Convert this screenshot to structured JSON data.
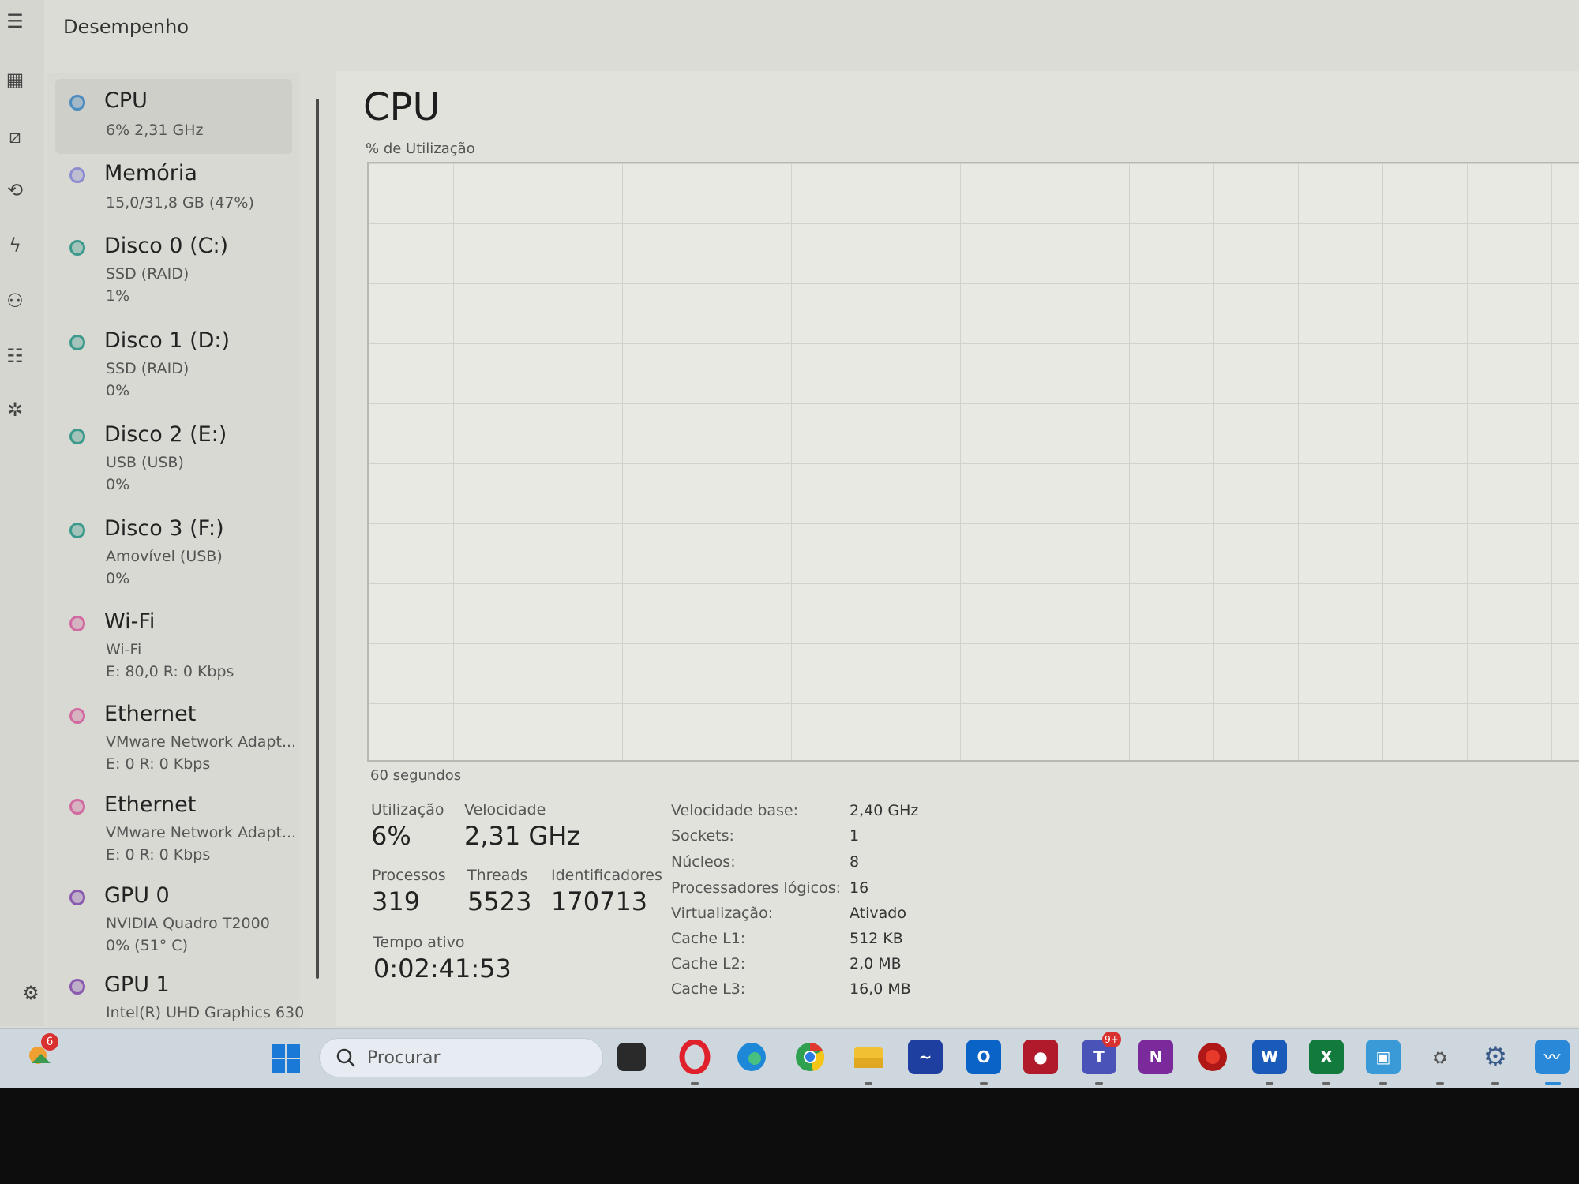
{
  "header": {
    "title": "Desempenho"
  },
  "devices": [
    {
      "name": "CPU",
      "lines": [
        "6%  2,31 GHz"
      ],
      "color": "#4a8bc0"
    },
    {
      "name": "Memória",
      "lines": [
        "15,0/31,8 GB (47%)"
      ],
      "color": "#8c8cd0"
    },
    {
      "name": "Disco 0 (C:)",
      "lines": [
        "SSD (RAID)",
        "1%"
      ],
      "color": "#3c9a8c"
    },
    {
      "name": "Disco 1 (D:)",
      "lines": [
        "SSD (RAID)",
        "0%"
      ],
      "color": "#3c9a8c"
    },
    {
      "name": "Disco 2 (E:)",
      "lines": [
        "USB (USB)",
        "0%"
      ],
      "color": "#3c9a8c"
    },
    {
      "name": "Disco 3 (F:)",
      "lines": [
        "Amovível (USB)",
        "0%"
      ],
      "color": "#3c9a8c"
    },
    {
      "name": "Wi-Fi",
      "lines": [
        "Wi-Fi",
        "E: 80,0  R: 0 Kbps"
      ],
      "color": "#d06aa0"
    },
    {
      "name": "Ethernet",
      "lines": [
        "VMware Network Adapt...",
        "E: 0  R: 0 Kbps"
      ],
      "color": "#d06aa0"
    },
    {
      "name": "Ethernet",
      "lines": [
        "VMware Network Adapt...",
        "E: 0  R: 0 Kbps"
      ],
      "color": "#d06aa0"
    },
    {
      "name": "GPU 0",
      "lines": [
        "NVIDIA Quadro T2000",
        "0%  (51° C)"
      ],
      "color": "#8a5ab0"
    },
    {
      "name": "GPU 1",
      "lines": [
        "Intel(R) UHD Graphics 630"
      ],
      "color": "#8a5ab0"
    }
  ],
  "main": {
    "title": "CPU",
    "graph_label": "% de Utilização",
    "time_label": "60 segundos",
    "stats": {
      "utilizacao_label": "Utilização",
      "utilizacao": "6%",
      "velocidade_label": "Velocidade",
      "velocidade": "2,31 GHz",
      "processos_label": "Processos",
      "processos": "319",
      "threads_label": "Threads",
      "threads": "5523",
      "identificadores_label": "Identificadores",
      "identificadores": "170713",
      "tempo_label": "Tempo ativo",
      "tempo": "0:02:41:53"
    },
    "specs": [
      {
        "label": "Velocidade base:",
        "value": "2,40 GHz"
      },
      {
        "label": "Sockets:",
        "value": "1"
      },
      {
        "label": "Núcleos:",
        "value": "8"
      },
      {
        "label": "Processadores lógicos:",
        "value": "16"
      },
      {
        "label": "Virtualização:",
        "value": "Ativado"
      },
      {
        "label": "Cache L1:",
        "value": "512 KB"
      },
      {
        "label": "Cache L2:",
        "value": "2,0 MB"
      },
      {
        "label": "Cache L3:",
        "value": "16,0 MB"
      }
    ]
  },
  "taskbar": {
    "weather_badge": "6",
    "search_placeholder": "Procurar",
    "teams_badge": "9+"
  }
}
